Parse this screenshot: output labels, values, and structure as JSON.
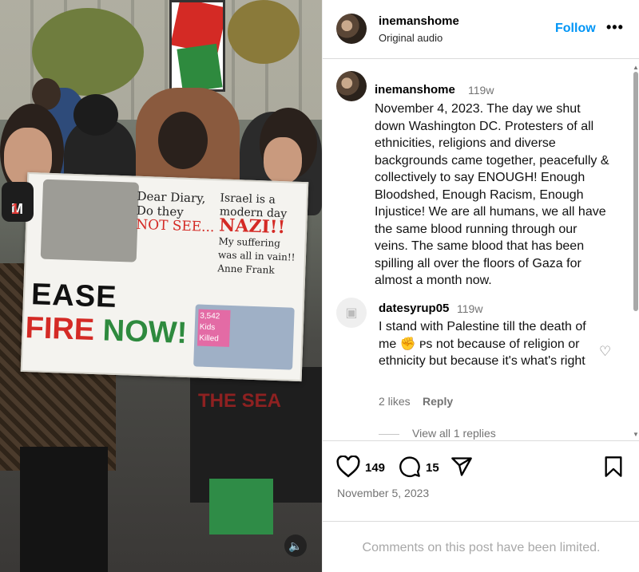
{
  "header": {
    "username": "inemanshome",
    "audio": "Original audio",
    "follow_label": "Follow",
    "more_label": "•••"
  },
  "caption": {
    "username": "inemanshome",
    "time": "119w",
    "text": "November 4, 2023. The day we shut down Washington DC. Protesters of all ethnicities, religions and diverse backgrounds came together, peacefully & collectively to say ENOUGH! Enough Bloodshed, Enough Racism, Enough Injustice! We are all humans, we all have the same blood running through our veins. The same blood that has been spilling all over the floors of Gaza for almost a month now."
  },
  "comment": {
    "username": "datesyrup05",
    "time": "119w",
    "text": "I stand with Palestine till the death of me ✊ ᴘs not because of religion or ethnicity but because it's what's right",
    "likes": "2 likes",
    "reply_label": "Reply",
    "view_replies": "View all 1 replies"
  },
  "actions": {
    "like_count": "149",
    "comment_count": "15",
    "date": "November 5, 2023"
  },
  "footer": {
    "limited": "Comments on this post have been limited."
  },
  "media": {
    "poster_diary": "Dear Diary, Do they",
    "poster_notsee": "NOT SEE...",
    "poster_israel": "Israel is a modern day",
    "poster_nazi": "NAZI!!",
    "poster_suffering": "My suffering was all in vain!! Anne Frank",
    "poster_ease": "EASE",
    "poster_fire": "FIRE",
    "poster_now": "NOW!",
    "poster_kids": "3,542 Kids Killed",
    "banner_text": "THE SEA",
    "mic_text_1": "M",
    "mic_text_2": "1"
  },
  "icons": {
    "heart": "heart-icon",
    "comment": "comment-icon",
    "share": "share-icon",
    "bookmark": "bookmark-icon",
    "sound": "sound-icon"
  }
}
